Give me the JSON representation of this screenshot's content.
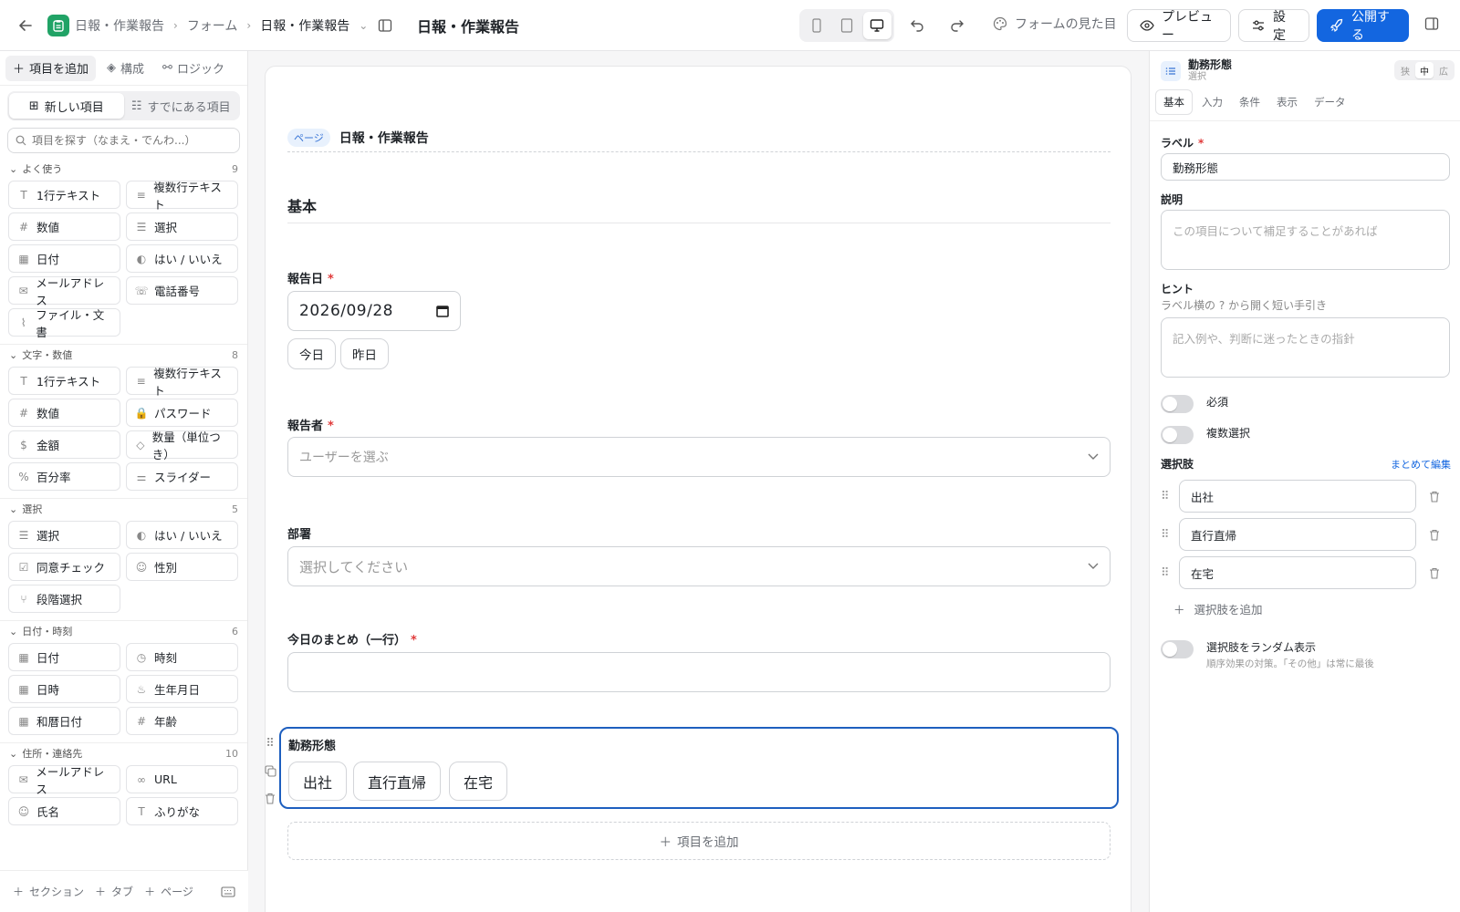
{
  "topbar": {
    "breadcrumb": [
      "日報・作業報告",
      "フォーム",
      "日報・作業報告"
    ],
    "title": "日報・作業報告",
    "appearance": "フォームの見た目",
    "preview": "プレビュー",
    "settings": "設定",
    "publish": "公開する"
  },
  "left": {
    "tabs": [
      "項目を追加",
      "構成",
      "ロジック"
    ],
    "segments": [
      "新しい項目",
      "すでにある項目"
    ],
    "search_placeholder": "項目を探す（なまえ・でんわ...）",
    "groups": [
      {
        "name": "よく使う",
        "count": "9",
        "items": [
          {
            "icon": "T",
            "label": "1行テキスト"
          },
          {
            "icon": "≡",
            "label": "複数行テキスト"
          },
          {
            "icon": "#",
            "label": "数値"
          },
          {
            "icon": "☰",
            "label": "選択"
          },
          {
            "icon": "▦",
            "label": "日付"
          },
          {
            "icon": "◐",
            "label": "はい / いいえ"
          },
          {
            "icon": "✉",
            "label": "メールアドレス"
          },
          {
            "icon": "☏",
            "label": "電話番号"
          },
          {
            "icon": "⌇",
            "label": "ファイル・文書"
          }
        ]
      },
      {
        "name": "文字・数値",
        "count": "8",
        "items": [
          {
            "icon": "T",
            "label": "1行テキスト"
          },
          {
            "icon": "≡",
            "label": "複数行テキスト"
          },
          {
            "icon": "#",
            "label": "数値"
          },
          {
            "icon": "🔒",
            "label": "パスワード"
          },
          {
            "icon": "$",
            "label": "金額"
          },
          {
            "icon": "◇",
            "label": "数量（単位つき）"
          },
          {
            "icon": "%",
            "label": "百分率"
          },
          {
            "icon": "⚌",
            "label": "スライダー"
          }
        ]
      },
      {
        "name": "選択",
        "count": "5",
        "items": [
          {
            "icon": "☰",
            "label": "選択"
          },
          {
            "icon": "◐",
            "label": "はい / いいえ"
          },
          {
            "icon": "☑",
            "label": "同意チェック"
          },
          {
            "icon": "☺",
            "label": "性別"
          },
          {
            "icon": "⑂",
            "label": "段階選択"
          }
        ]
      },
      {
        "name": "日付・時刻",
        "count": "6",
        "items": [
          {
            "icon": "▦",
            "label": "日付"
          },
          {
            "icon": "◷",
            "label": "時刻"
          },
          {
            "icon": "▦",
            "label": "日時"
          },
          {
            "icon": "♨",
            "label": "生年月日"
          },
          {
            "icon": "▦",
            "label": "和暦日付"
          },
          {
            "icon": "#",
            "label": "年齢"
          }
        ]
      },
      {
        "name": "住所・連絡先",
        "count": "10",
        "items": [
          {
            "icon": "✉",
            "label": "メールアドレス"
          },
          {
            "icon": "∞",
            "label": "URL"
          },
          {
            "icon": "☺",
            "label": "氏名"
          },
          {
            "icon": "T",
            "label": "ふりがな"
          }
        ]
      }
    ],
    "footer": [
      "セクション",
      "タブ",
      "ページ"
    ]
  },
  "form": {
    "page_badge": "ページ",
    "page_title": "日報・作業報告",
    "section_title": "基本",
    "date_label": "報告日",
    "date_value": "2026/09/28",
    "date_chips": [
      "今日",
      "昨日"
    ],
    "reporter_label": "報告者",
    "reporter_placeholder": "ユーザーを選ぶ",
    "dept_label": "部署",
    "dept_placeholder": "選択してください",
    "summary_label": "今日のまとめ（一行）",
    "work_label": "勤務形態",
    "work_options": [
      "出社",
      "直行直帰",
      "在宅"
    ],
    "add_field": "項目を追加",
    "required_mark": "*"
  },
  "right": {
    "field_name": "勤務形態",
    "field_type": "選択",
    "sizes": [
      "狭",
      "中",
      "広"
    ],
    "tabs": [
      "基本",
      "入力",
      "条件",
      "表示",
      "データ"
    ],
    "label_title": "ラベル",
    "label_value": "勤務形態",
    "desc_title": "説明",
    "desc_placeholder": "この項目について補足することがあれば",
    "hint_title": "ヒント",
    "hint_sub": "ラベル横の ? から開く短い手引き",
    "hint_placeholder": "記入例や、判断に迷ったときの指針",
    "required": "必須",
    "multi": "複数選択",
    "options_title": "選択肢",
    "bulk_edit": "まとめて編集",
    "options": [
      "出社",
      "直行直帰",
      "在宅"
    ],
    "add_option": "選択肢を追加",
    "random": "選択肢をランダム表示",
    "random_sub": "順序効果の対策。「その他」は常に最後"
  },
  "colors": {
    "primary": "#1366e0",
    "accent_green": "#21a366",
    "required": "#e03a3a",
    "selected_border": "#1e5fbf"
  }
}
